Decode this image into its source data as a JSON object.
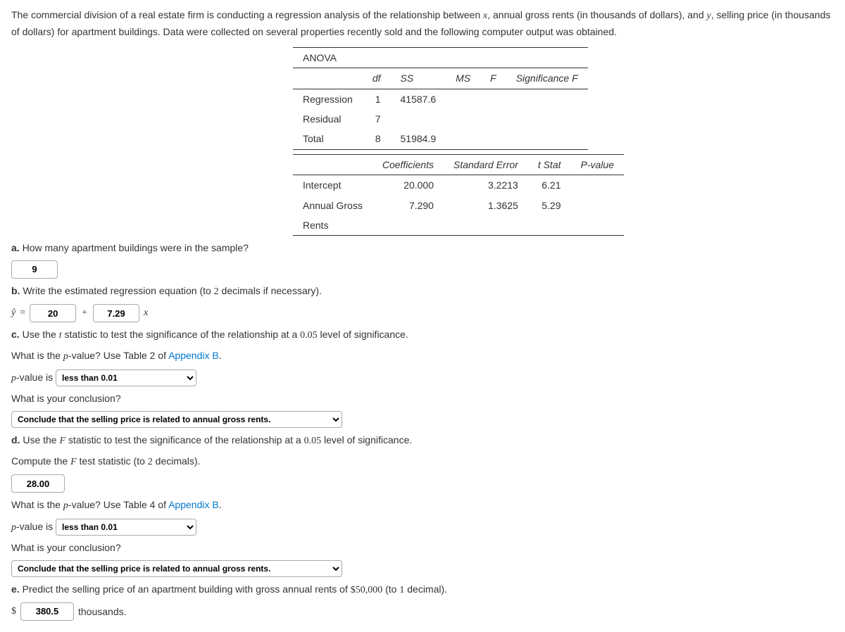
{
  "intro": {
    "line1_a": "The commercial division of a real estate firm is conducting a regression analysis of the relationship between ",
    "xvar": "x",
    "line1_b": ", annual gross rents (in thousands of dollars), and ",
    "yvar": "y",
    "line1_c": ", selling price (in thousands of dollars) for apartment buildings. Data were collected on several properties recently sold and the following computer output was obtained."
  },
  "anova": {
    "title": "ANOVA",
    "headers": {
      "df": "df",
      "ss": "SS",
      "ms": "MS",
      "f": "F",
      "sigf": "Significance F"
    },
    "rows": {
      "regression": {
        "label": "Regression",
        "df": "1",
        "ss": "41587.6"
      },
      "residual": {
        "label": "Residual",
        "df": "7"
      },
      "total": {
        "label": "Total",
        "df": "8",
        "ss": "51984.9"
      }
    }
  },
  "coef": {
    "headers": {
      "coef": "Coefficients",
      "se": "Standard Error",
      "t": "t Stat",
      "p": "P-value"
    },
    "intercept": {
      "label": "Intercept",
      "coef": "20.000",
      "se": "3.2213",
      "t": "6.21"
    },
    "slope": {
      "label": "Annual Gross Rents",
      "label_a": "Annual Gross",
      "label_b": "Rents",
      "coef": "7.290",
      "se": "1.3625",
      "t": "5.29"
    }
  },
  "parts": {
    "a": {
      "tag": "a.",
      "q": "How many apartment buildings were in the sample?",
      "ans": "9"
    },
    "b": {
      "tag": "b.",
      "q": "Write the estimated regression equation (to ",
      "dec": "2",
      "q2": " decimals if necessary).",
      "yhat": "ŷ",
      "eq": "=",
      "intercept": "20",
      "plus": "+",
      "slope": "7.29",
      "x": "x"
    },
    "c": {
      "tag": "c.",
      "q1a": "Use the ",
      "tvar": "t",
      "q1b": " statistic to test the significance of the relationship at a ",
      "alpha": "0.05",
      "q1c": " level of significance.",
      "pvar": "p",
      "q2a": "What is the ",
      "q2b": "-value? Use Table 2 of ",
      "appendix": "Appendix B",
      "q2c": ".",
      "pvlabel_a": "-value is",
      "p_select": "less than 0.01",
      "concl_q": "What is your conclusion?",
      "concl_select": "Conclude that the selling price is related to annual gross rents."
    },
    "d": {
      "tag": "d.",
      "q1a": "Use the ",
      "fvar": "F",
      "q1b": " statistic to test the significance of the relationship at a ",
      "alpha": "0.05",
      "q1c": " level of significance.",
      "q2a": "Compute the ",
      "q2b": " test statistic (to ",
      "dec": "2",
      "q2c": " decimals).",
      "fstat": "28.00",
      "pvar": "p",
      "q3a": "What is the ",
      "q3b": "-value? Use Table 4 of ",
      "appendix": "Appendix B",
      "q3c": ".",
      "pvlabel_a": "-value is",
      "p_select": "less than 0.01",
      "concl_q": "What is your conclusion?",
      "concl_select": "Conclude that the selling price is related to annual gross rents."
    },
    "e": {
      "tag": "e.",
      "q_a": "Predict the selling price of an apartment building with gross annual rents of ",
      "amount": "$50,000",
      "q_b": " (to ",
      "dec": "1",
      "q_c": " decimal).",
      "dollar": "$",
      "ans": "380.5",
      "units": "thousands."
    }
  }
}
